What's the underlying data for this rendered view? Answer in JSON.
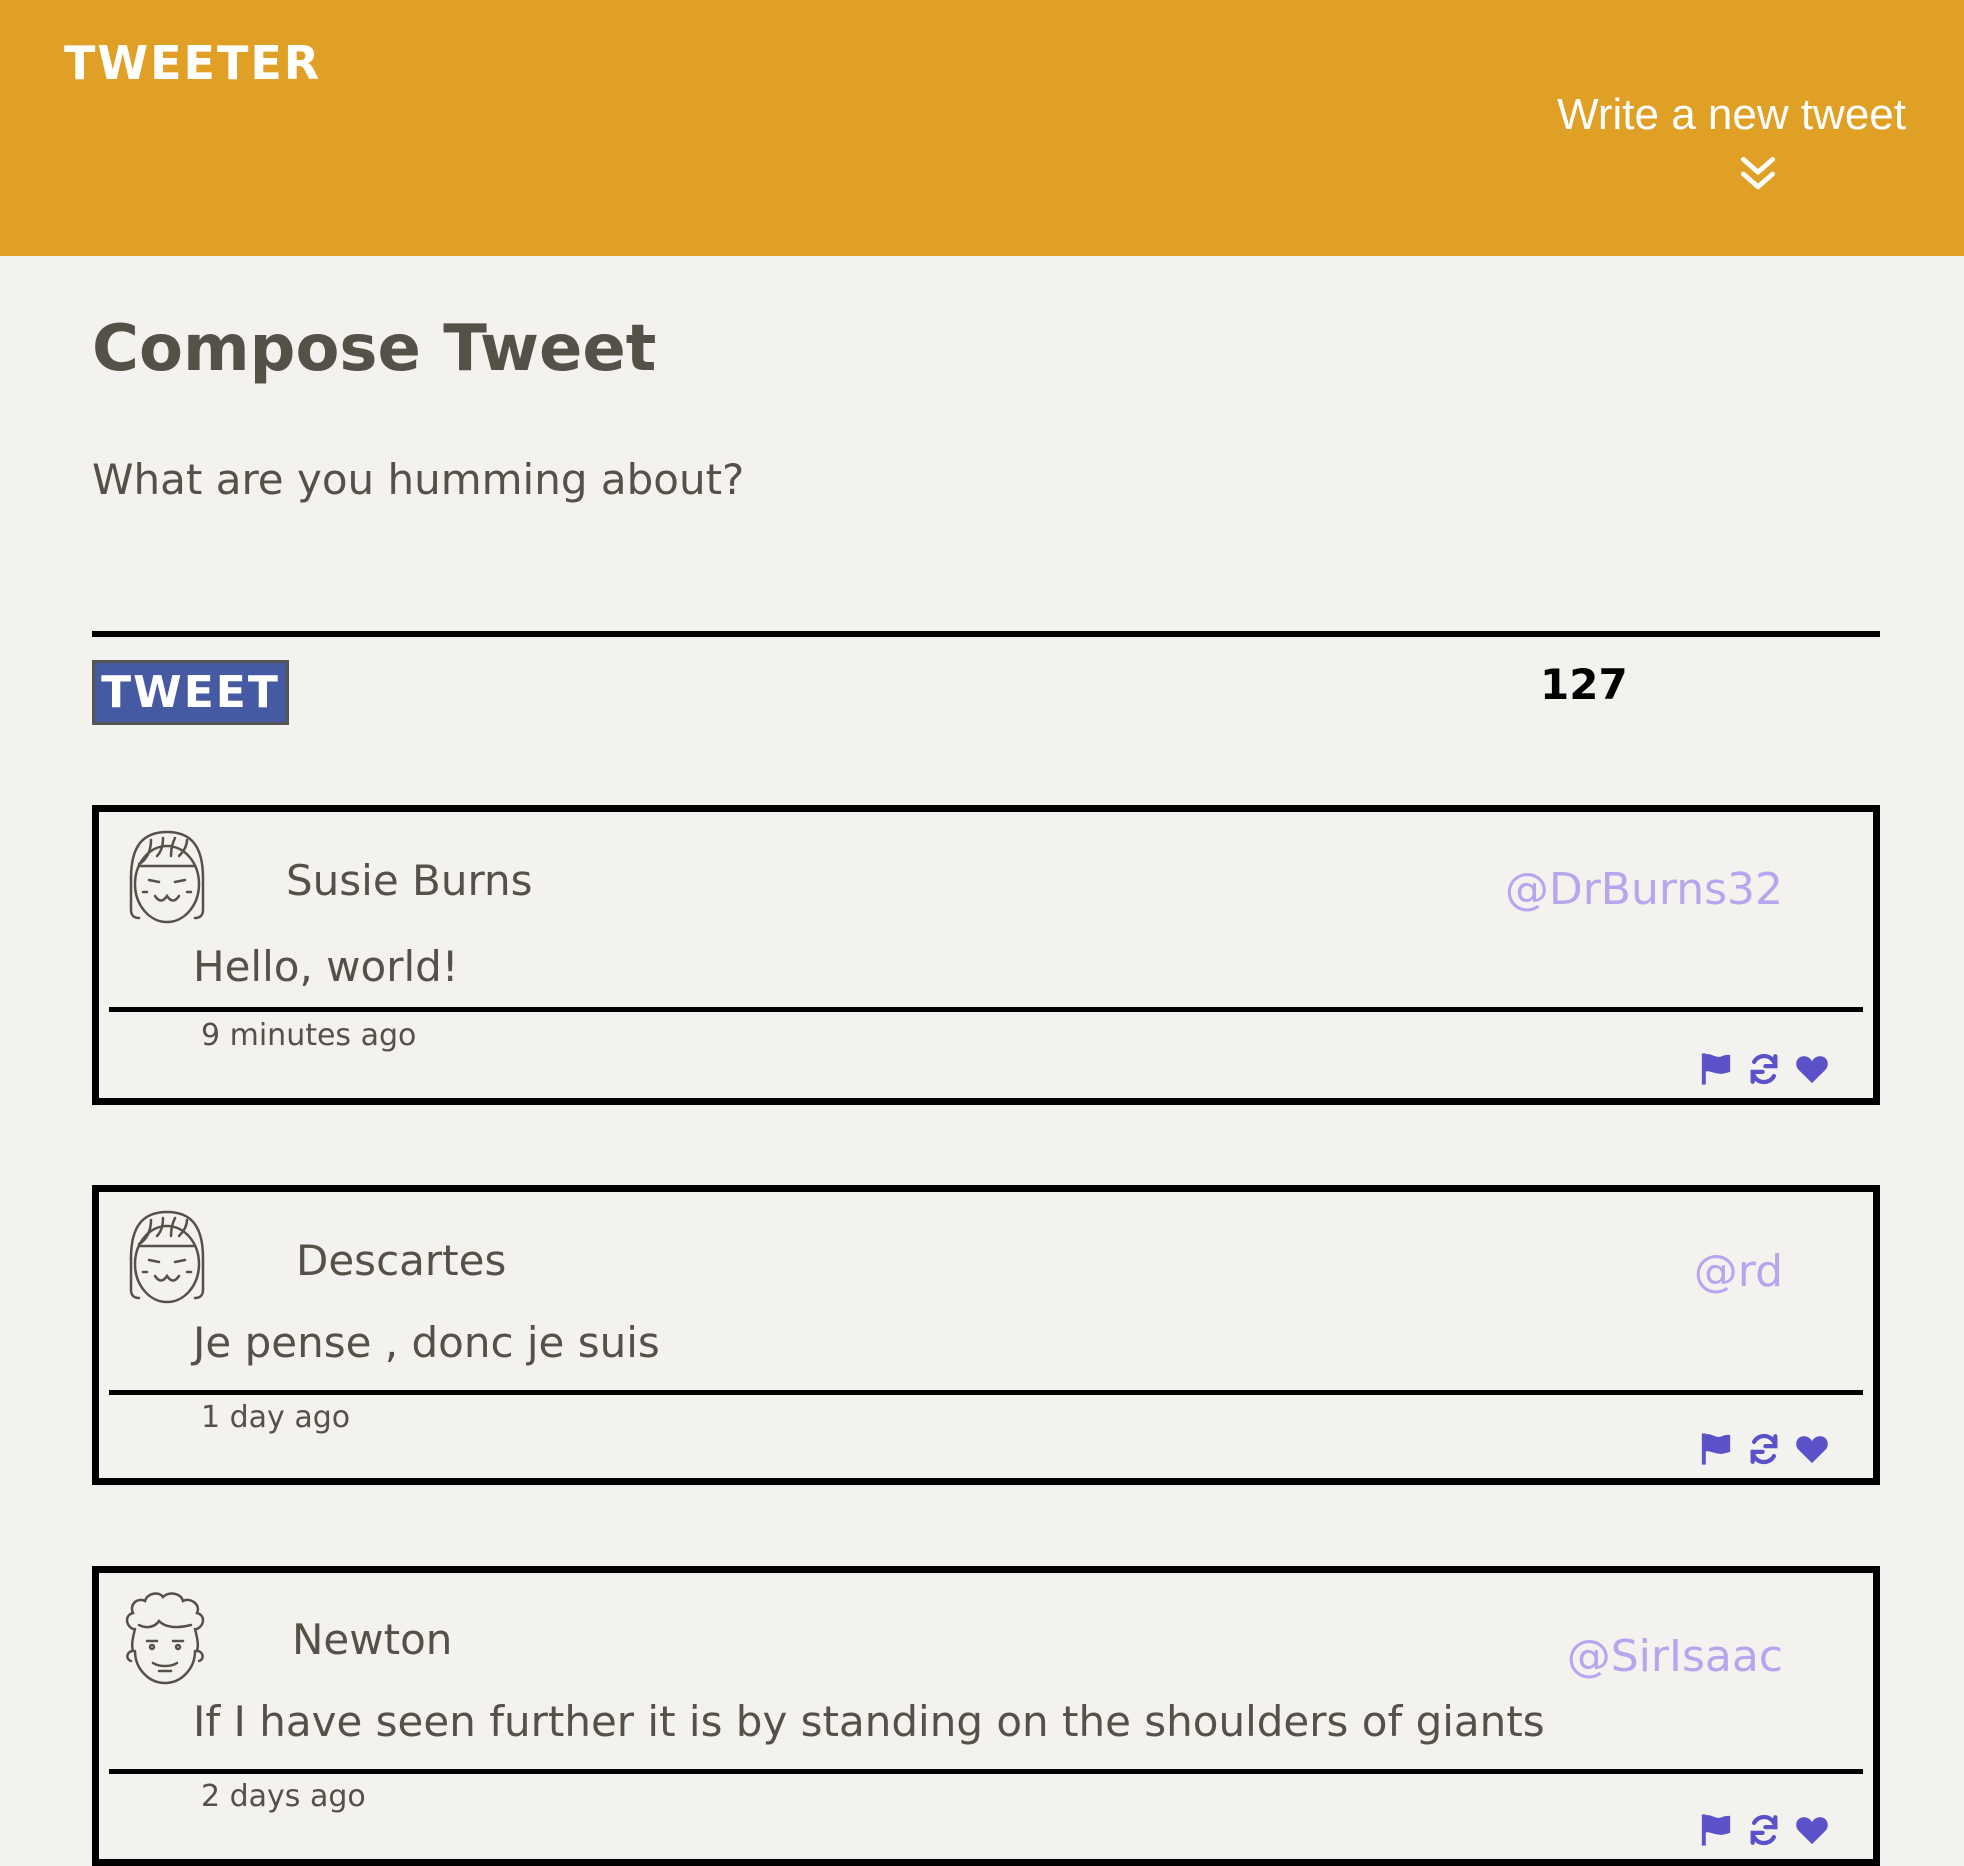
{
  "header": {
    "brand": "TWEETER",
    "compose_toggle_label": "Write a new tweet",
    "compose_toggle_icon": "double-chevron-down-icon"
  },
  "compose": {
    "title": "Compose Tweet",
    "placeholder": "What are you humming about?",
    "submit_label": "TWEET",
    "char_counter": "127"
  },
  "colors": {
    "header_bg": "#e0a026",
    "page_bg": "#f4f2ee",
    "button_bg": "#4659a3",
    "handle": "#b6a6ee",
    "action_icons": "#5b51c8",
    "text": "#545149"
  },
  "tweets": [
    {
      "name": "Susie Burns",
      "handle": "@DrBurns32",
      "body": "Hello, world!",
      "time": "9 minutes ago",
      "avatar": "girl-avatar-icon",
      "actions": [
        "flag-icon",
        "retweet-icon",
        "heart-icon"
      ]
    },
    {
      "name": "Descartes",
      "handle": "@rd",
      "body": "Je pense , donc je suis",
      "time": "1 day ago",
      "avatar": "girl-avatar-icon",
      "actions": [
        "flag-icon",
        "retweet-icon",
        "heart-icon"
      ]
    },
    {
      "name": "Newton",
      "handle": "@SirIsaac",
      "body": "If I have seen further it is by standing on the shoulders of giants",
      "time": "2 days ago",
      "avatar": "curly-hair-avatar-icon",
      "actions": [
        "flag-icon",
        "retweet-icon",
        "heart-icon"
      ]
    }
  ]
}
